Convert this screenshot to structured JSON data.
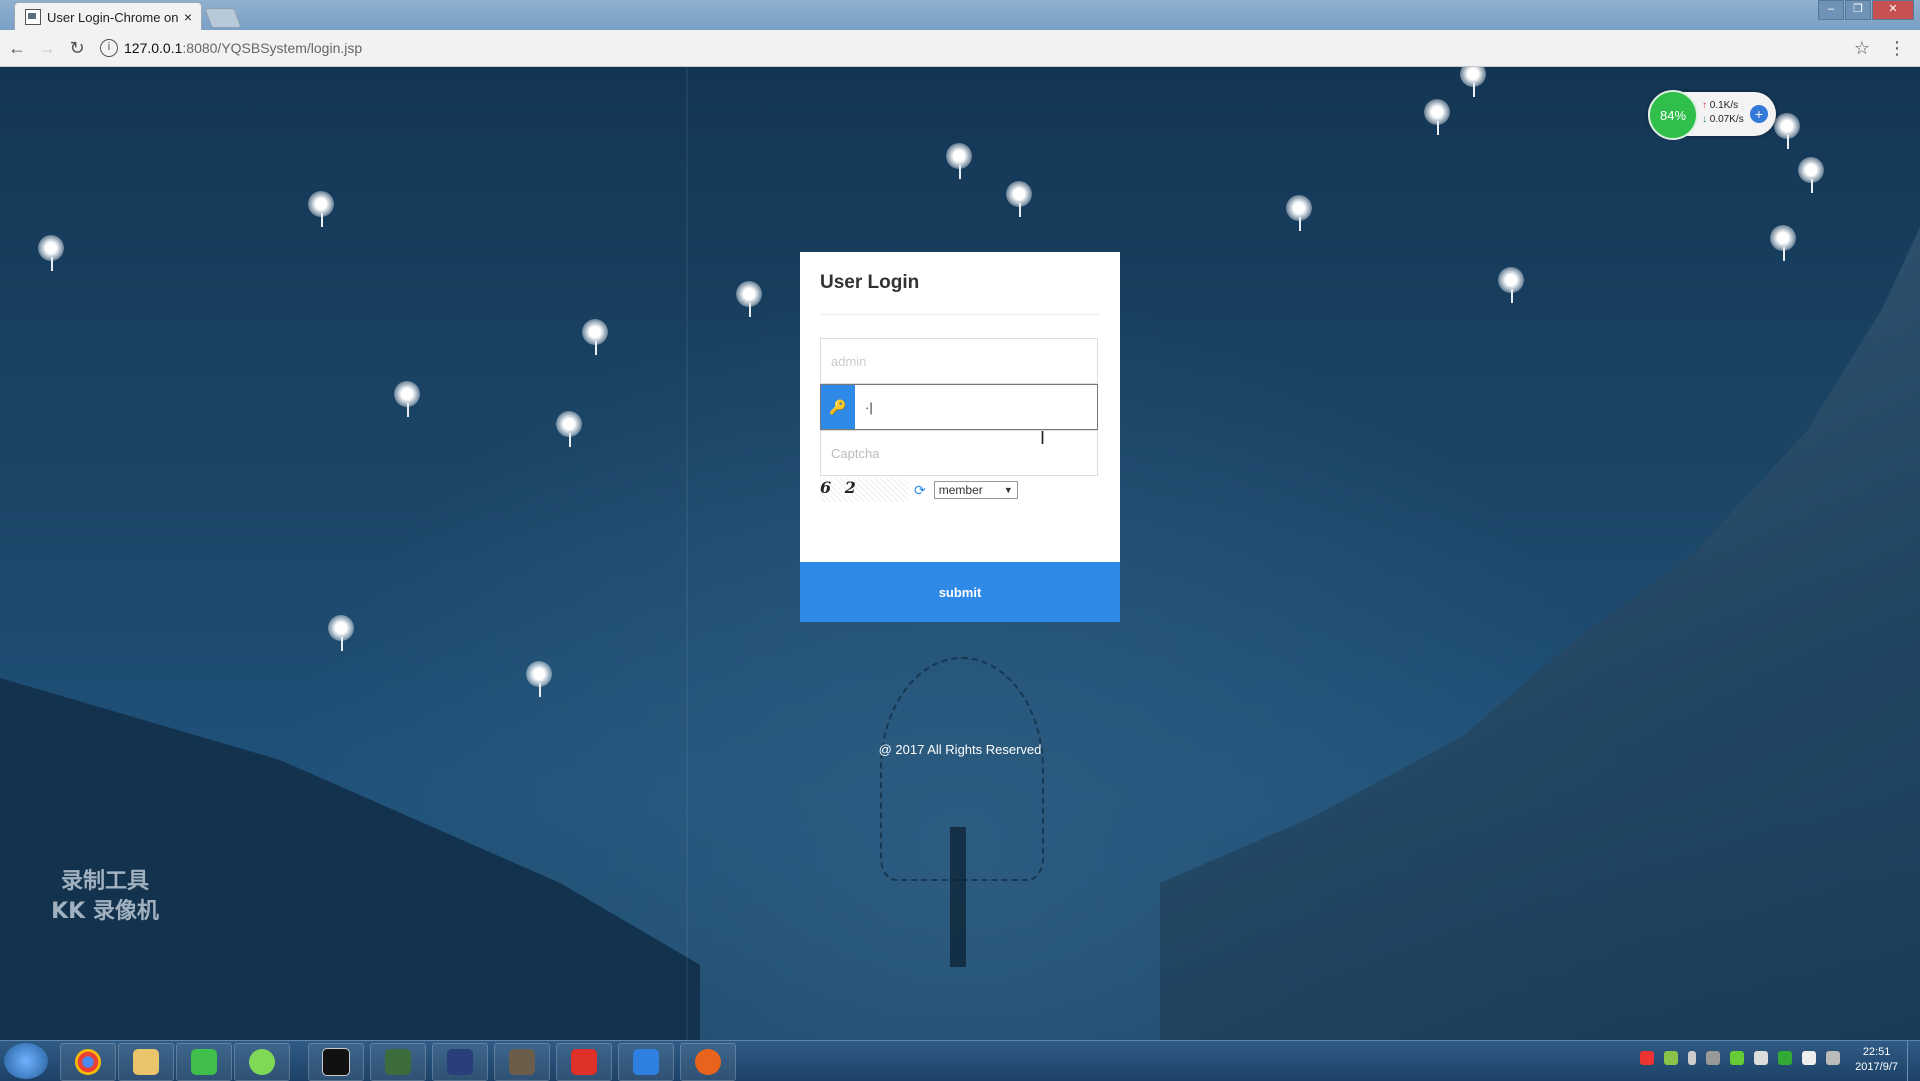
{
  "browser": {
    "tab_title": "User Login-Chrome on",
    "tab_close": "×",
    "url_host": "127.0.0.1",
    "url_path": ":8080/YQSBSystem/login.jsp",
    "back": "←",
    "forward": "→",
    "reload": "↻",
    "info": "i",
    "bookmark": "☆",
    "menu": "⋮",
    "window_controls": {
      "minimize": "–",
      "restore": "❐",
      "close": "✕"
    }
  },
  "login": {
    "title": "User Login",
    "username_value": "admin",
    "password_value": "·|",
    "captcha_placeholder": "Captcha",
    "captcha_text": "6 2",
    "refresh_icon": "⟳",
    "role_selected": "member",
    "submit_label": "submit",
    "footer": "@ 2017 All Rights Reserved"
  },
  "net_widget": {
    "percent": "84%",
    "upload": "0.1K/s",
    "download": "0.07K/s",
    "plus": "+"
  },
  "watermark": {
    "line1": "录制工具",
    "line2": "KK 录像机"
  },
  "taskbar": {
    "apps": [
      "windows-start",
      "chrome",
      "file-explorer",
      "wechat",
      "green-app",
      "cmd-terminal",
      "monitor-app",
      "s-app",
      "sublime",
      "netease-music",
      "wps-writer",
      "blackhole-app"
    ],
    "clock_time": "22:51",
    "clock_date": "2017/9/7"
  },
  "colors": {
    "accent": "#2f89e6",
    "page_bg": "#1a3f5f"
  }
}
